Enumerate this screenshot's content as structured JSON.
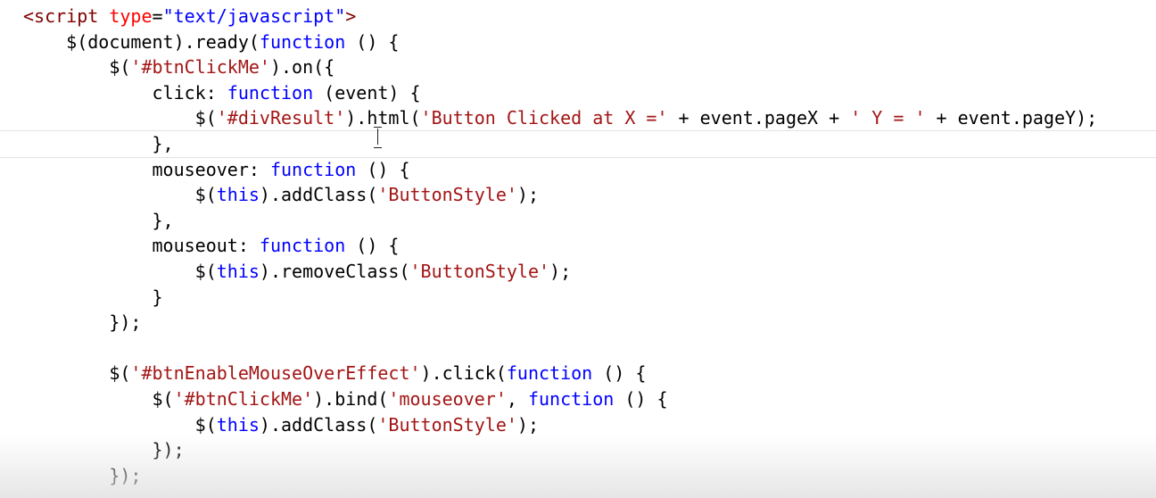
{
  "editor": {
    "lines": [
      [
        {
          "t": "<script",
          "c": "tag"
        },
        {
          "t": " ",
          "c": "plain"
        },
        {
          "t": "type",
          "c": "attr"
        },
        {
          "t": "=",
          "c": "plain"
        },
        {
          "t": "\"text/javascript\"",
          "c": "attrval"
        },
        {
          "t": ">",
          "c": "tag"
        }
      ],
      [
        {
          "t": "    $(document).ready(",
          "c": "plain"
        },
        {
          "t": "function",
          "c": "kw"
        },
        {
          "t": " () {",
          "c": "plain"
        }
      ],
      [
        {
          "t": "        $(",
          "c": "plain"
        },
        {
          "t": "'#btnClickMe'",
          "c": "str"
        },
        {
          "t": ").on({",
          "c": "plain"
        }
      ],
      [
        {
          "t": "            click: ",
          "c": "plain"
        },
        {
          "t": "function",
          "c": "kw"
        },
        {
          "t": " (event) {",
          "c": "plain"
        }
      ],
      [
        {
          "t": "                $(",
          "c": "plain"
        },
        {
          "t": "'#divResult'",
          "c": "str"
        },
        {
          "t": ").html(",
          "c": "plain"
        },
        {
          "t": "'Button Clicked at X ='",
          "c": "str"
        },
        {
          "t": " + event.pageX + ",
          "c": "plain"
        },
        {
          "t": "' Y = '",
          "c": "str"
        },
        {
          "t": " + event.pageY);",
          "c": "plain"
        }
      ],
      [
        {
          "t": "            },",
          "c": "plain"
        }
      ],
      [
        {
          "t": "            mouseover: ",
          "c": "plain"
        },
        {
          "t": "function",
          "c": "kw"
        },
        {
          "t": " () {",
          "c": "plain"
        }
      ],
      [
        {
          "t": "                $(",
          "c": "plain"
        },
        {
          "t": "this",
          "c": "kw"
        },
        {
          "t": ").addClass(",
          "c": "plain"
        },
        {
          "t": "'ButtonStyle'",
          "c": "str"
        },
        {
          "t": ");",
          "c": "plain"
        }
      ],
      [
        {
          "t": "            },",
          "c": "plain"
        }
      ],
      [
        {
          "t": "            mouseout: ",
          "c": "plain"
        },
        {
          "t": "function",
          "c": "kw"
        },
        {
          "t": " () {",
          "c": "plain"
        }
      ],
      [
        {
          "t": "                $(",
          "c": "plain"
        },
        {
          "t": "this",
          "c": "kw"
        },
        {
          "t": ").removeClass(",
          "c": "plain"
        },
        {
          "t": "'ButtonStyle'",
          "c": "str"
        },
        {
          "t": ");",
          "c": "plain"
        }
      ],
      [
        {
          "t": "            }",
          "c": "plain"
        }
      ],
      [
        {
          "t": "        });",
          "c": "plain"
        }
      ],
      [
        {
          "t": "",
          "c": "plain"
        }
      ],
      [
        {
          "t": "        $(",
          "c": "plain"
        },
        {
          "t": "'#btnEnableMouseOverEffect'",
          "c": "str"
        },
        {
          "t": ").click(",
          "c": "plain"
        },
        {
          "t": "function",
          "c": "kw"
        },
        {
          "t": " () {",
          "c": "plain"
        }
      ],
      [
        {
          "t": "            $(",
          "c": "plain"
        },
        {
          "t": "'#btnClickMe'",
          "c": "str"
        },
        {
          "t": ").bind(",
          "c": "plain"
        },
        {
          "t": "'mouseover'",
          "c": "str"
        },
        {
          "t": ", ",
          "c": "plain"
        },
        {
          "t": "function",
          "c": "kw"
        },
        {
          "t": " () {",
          "c": "plain"
        }
      ],
      [
        {
          "t": "                $(",
          "c": "plain"
        },
        {
          "t": "this",
          "c": "kw"
        },
        {
          "t": ").addClass(",
          "c": "plain"
        },
        {
          "t": "'ButtonStyle'",
          "c": "str"
        },
        {
          "t": ");",
          "c": "plain"
        }
      ],
      [
        {
          "t": "            });",
          "c": "plain"
        }
      ],
      [
        {
          "t": "        });",
          "c": "plain"
        }
      ]
    ],
    "current_line": 5,
    "colors": {
      "tag": "#800000",
      "attr": "#ff0000",
      "attrval": "#0000ff",
      "keyword": "#0000ff",
      "string": "#a31515",
      "plain": "#000000"
    },
    "cursor_icon": "ibeam-cursor-icon"
  }
}
